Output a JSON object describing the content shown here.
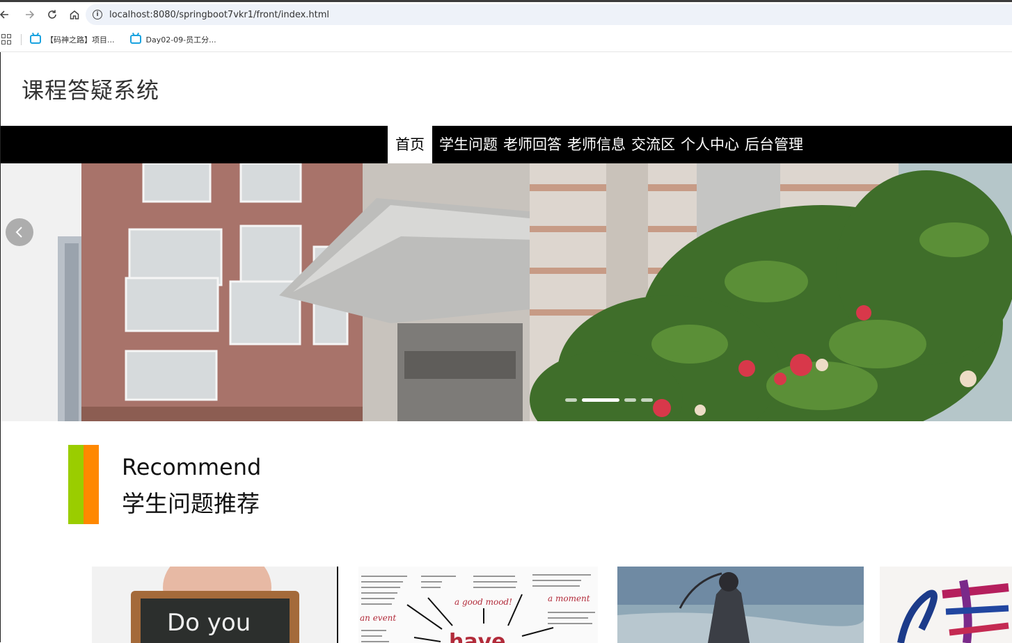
{
  "browser": {
    "url": "localhost:8080/springboot7vkr1/front/index.html",
    "bookmarks": [
      {
        "label": "【码神之路】项目..."
      },
      {
        "label": "Day02-09-员工分..."
      }
    ]
  },
  "site": {
    "title": "课程答疑系统"
  },
  "nav": {
    "items": [
      {
        "label": "首页"
      },
      {
        "label": "学生问题"
      },
      {
        "label": "老师回答"
      },
      {
        "label": "老师信息"
      },
      {
        "label": "交流区"
      },
      {
        "label": "个人中心"
      },
      {
        "label": "后台管理"
      }
    ],
    "active_index": 0
  },
  "carousel": {
    "slide_count": 4,
    "active_index": 1
  },
  "recommend": {
    "title_en": "Recommend",
    "title_cn": "学生问题推荐",
    "colors": {
      "left_bar": "#9acd00",
      "right_bar": "#ff8800"
    }
  },
  "cards": {
    "items": [
      {
        "caption": "Do you"
      },
      {
        "labels": [
          "a good mood!",
          "a moment",
          "an event",
          "have"
        ]
      },
      {},
      {}
    ]
  }
}
